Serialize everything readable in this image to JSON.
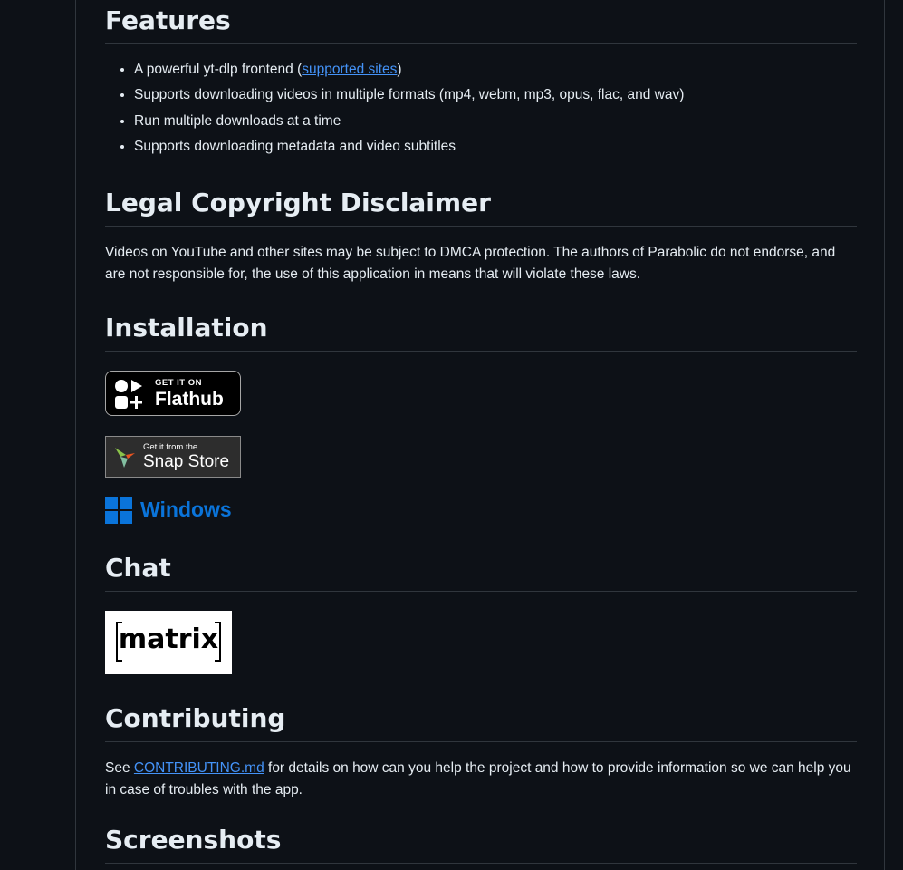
{
  "features": {
    "heading": "Features",
    "items": [
      {
        "before": "A powerful yt-dlp frontend (",
        "link": "supported sites",
        "after": ")"
      },
      {
        "text": "Supports downloading videos in multiple formats (mp4, webm, mp3, opus, flac, and wav)"
      },
      {
        "text": "Run multiple downloads at a time"
      },
      {
        "text": "Supports downloading metadata and video subtitles"
      }
    ]
  },
  "legal": {
    "heading": "Legal Copyright Disclaimer",
    "text": "Videos on YouTube and other sites may be subject to DMCA protection. The authors of Parabolic do not endorse, and are not responsible for, the use of this application in means that will violate these laws."
  },
  "installation": {
    "heading": "Installation",
    "flathub": {
      "small": "GET IT ON",
      "big": "Flathub"
    },
    "snap": {
      "small": "Get it from the",
      "big": "Snap Store"
    },
    "windows": {
      "label": "Windows",
      "color": "#0a74da"
    }
  },
  "chat": {
    "heading": "Chat",
    "matrix_label": "matrix"
  },
  "contributing": {
    "heading": "Contributing",
    "before": "See ",
    "link": "CONTRIBUTING.md",
    "after": " for details on how can you help the project and how to provide information so we can help you in case of troubles with the app."
  },
  "screenshots": {
    "heading": "Screenshots"
  },
  "colors": {
    "background": "#0d1117",
    "text": "#e6edf3",
    "link": "#4493f8",
    "border": "#30363d"
  }
}
